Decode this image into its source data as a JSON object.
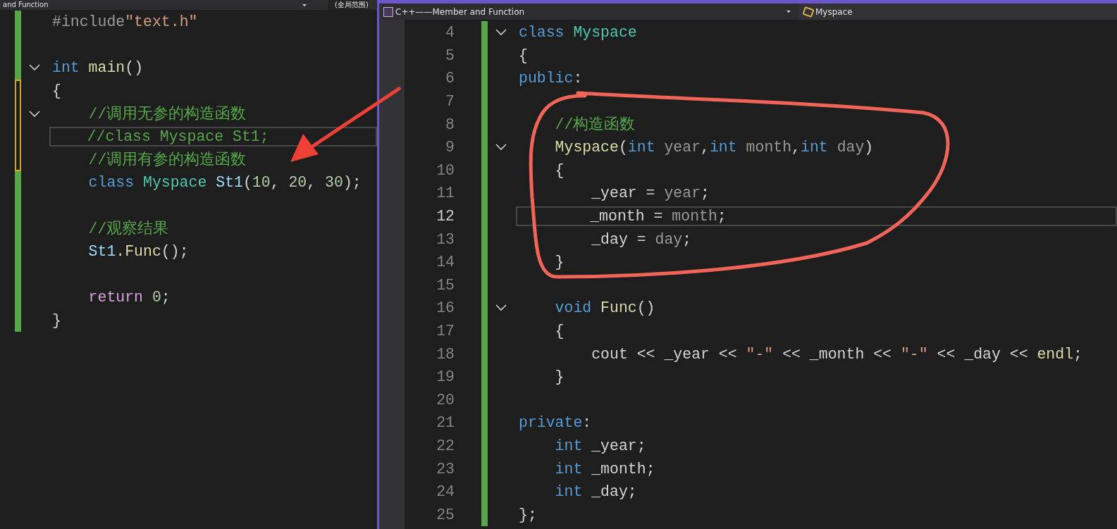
{
  "left_pane": {
    "nav_bar": {
      "project": "and Function",
      "scope": "(全局范围)"
    },
    "lines": [
      {
        "saved": true,
        "fold": false,
        "current": false,
        "tokens": [
          {
            "kind": "macro",
            "text": "#include"
          },
          {
            "kind": "string",
            "text": "\"text.h\""
          }
        ]
      },
      {
        "saved": true,
        "fold": false,
        "current": false
      },
      {
        "saved": true,
        "fold": true,
        "current": false,
        "tokens": [
          {
            "kind": "keyword",
            "text": "int"
          },
          {
            "kind": "function",
            "text": " main"
          },
          {
            "kind": "plain",
            "text": "()"
          }
        ]
      },
      {
        "saved": false,
        "fold": false,
        "current": false,
        "tokens": [
          {
            "kind": "plain",
            "text": "{"
          }
        ],
        "children": [
          {
            "saved": false,
            "fold": true,
            "current": false,
            "tokens": [
              {
                "kind": "comment",
                "text": "//调用无参的构造函数"
              }
            ]
          },
          {
            "saved": false,
            "fold": false,
            "current": true,
            "tokens": [
              {
                "kind": "comment",
                "text": "//class Myspace St1;"
              }
            ]
          },
          {
            "saved": false,
            "fold": false,
            "current": false,
            "tokens": [
              {
                "kind": "comment",
                "text": "//调用有参的构造函数"
              }
            ]
          },
          {
            "saved": true,
            "fold": false,
            "current": false,
            "tokens": [
              {
                "kind": "keyword",
                "text": "class"
              },
              {
                "kind": "type",
                "text": " Myspace"
              },
              {
                "kind": "variable",
                "text": " St1"
              },
              {
                "kind": "plain",
                "text": "("
              },
              {
                "kind": "number",
                "text": "10"
              },
              {
                "kind": "plain",
                "text": ", "
              },
              {
                "kind": "number",
                "text": "20"
              },
              {
                "kind": "plain",
                "text": ", "
              },
              {
                "kind": "number",
                "text": "30"
              },
              {
                "kind": "plain",
                "text": ");"
              }
            ]
          },
          {
            "saved": true,
            "fold": false,
            "current": false
          },
          {
            "saved": true,
            "fold": false,
            "current": false,
            "tokens": [
              {
                "kind": "comment",
                "text": "//观察结果"
              }
            ]
          },
          {
            "saved": true,
            "fold": false,
            "current": false,
            "tokens": [
              {
                "kind": "variable",
                "text": "St1"
              },
              {
                "kind": "plain",
                "text": "."
              },
              {
                "kind": "function",
                "text": "Func"
              },
              {
                "kind": "plain",
                "text": "();"
              }
            ]
          },
          {
            "saved": true,
            "fold": false,
            "current": false
          },
          {
            "saved": true,
            "fold": false,
            "current": false,
            "tokens": [
              {
                "kind": "control",
                "text": "return"
              },
              {
                "kind": "number",
                "text": " 0"
              },
              {
                "kind": "plain",
                "text": ";"
              }
            ]
          }
        ]
      },
      {
        "saved": true,
        "fold": false,
        "current": false,
        "tokens": [
          {
            "kind": "plain",
            "text": "}"
          }
        ]
      }
    ]
  },
  "right_pane": {
    "nav_bar": {
      "project": "C++——Member and Function",
      "scope": "Myspace"
    },
    "lines": [
      {
        "number": "4",
        "saved": true,
        "fold": true,
        "current": false,
        "tokens": [
          {
            "kind": "keyword",
            "text": "class"
          },
          {
            "kind": "type",
            "text": " Myspace"
          }
        ]
      },
      {
        "number": "5",
        "saved": true,
        "fold": false,
        "current": false,
        "tokens": [
          {
            "kind": "plain",
            "text": "{"
          }
        ]
      },
      {
        "number": "6",
        "saved": true,
        "fold": false,
        "current": false,
        "tokens": [
          {
            "kind": "keyword",
            "text": "public"
          },
          {
            "kind": "plain",
            "text": ":"
          }
        ],
        "children": [
          {
            "number": "7",
            "saved": true,
            "fold": false,
            "current": false
          },
          {
            "number": "8",
            "saved": true,
            "fold": false,
            "current": false,
            "tokens": [
              {
                "kind": "comment",
                "text": "//构造函数"
              }
            ]
          },
          {
            "number": "9",
            "saved": true,
            "fold": true,
            "current": false,
            "tokens": [
              {
                "kind": "function",
                "text": "Myspace"
              },
              {
                "kind": "plain",
                "text": "("
              },
              {
                "kind": "keyword",
                "text": "int"
              },
              {
                "kind": "param",
                "text": " year"
              },
              {
                "kind": "plain",
                "text": ","
              },
              {
                "kind": "keyword",
                "text": "int"
              },
              {
                "kind": "param",
                "text": " month"
              },
              {
                "kind": "plain",
                "text": ","
              },
              {
                "kind": "keyword",
                "text": "int"
              },
              {
                "kind": "param",
                "text": " day"
              },
              {
                "kind": "plain",
                "text": ")"
              }
            ]
          },
          {
            "number": "10",
            "saved": true,
            "fold": false,
            "current": false,
            "tokens": [
              {
                "kind": "plain",
                "text": "{"
              }
            ],
            "children": [
              {
                "number": "11",
                "saved": true,
                "fold": false,
                "current": false,
                "tokens": [
                  {
                    "kind": "plain",
                    "text": "_year = "
                  },
                  {
                    "kind": "param",
                    "text": "year"
                  },
                  {
                    "kind": "plain",
                    "text": ";"
                  }
                ]
              },
              {
                "number": "12",
                "saved": true,
                "fold": false,
                "current": true,
                "tokens": [
                  {
                    "kind": "plain",
                    "text": "_month = "
                  },
                  {
                    "kind": "param",
                    "text": "month"
                  },
                  {
                    "kind": "plain",
                    "text": ";"
                  }
                ]
              },
              {
                "number": "13",
                "saved": true,
                "fold": false,
                "current": false,
                "tokens": [
                  {
                    "kind": "plain",
                    "text": "_day = "
                  },
                  {
                    "kind": "param",
                    "text": "day"
                  },
                  {
                    "kind": "plain",
                    "text": ";"
                  }
                ]
              }
            ]
          },
          {
            "number": "14",
            "saved": true,
            "fold": false,
            "current": false,
            "tokens": [
              {
                "kind": "plain",
                "text": "}"
              }
            ]
          },
          {
            "number": "15",
            "saved": true,
            "fold": false,
            "current": false
          },
          {
            "number": "16",
            "saved": true,
            "fold": true,
            "current": false,
            "tokens": [
              {
                "kind": "keyword",
                "text": "void"
              },
              {
                "kind": "function",
                "text": " Func"
              },
              {
                "kind": "plain",
                "text": "()"
              }
            ]
          },
          {
            "number": "17",
            "saved": true,
            "fold": false,
            "current": false,
            "tokens": [
              {
                "kind": "plain",
                "text": "{"
              }
            ],
            "children": [
              {
                "number": "18",
                "saved": true,
                "fold": false,
                "current": false,
                "tokens": [
                  {
                    "kind": "plain",
                    "text": "cout << _year << "
                  },
                  {
                    "kind": "string",
                    "text": "\"-\""
                  },
                  {
                    "kind": "plain",
                    "text": " << _month << "
                  },
                  {
                    "kind": "string",
                    "text": "\"-\""
                  },
                  {
                    "kind": "plain",
                    "text": " << _day << "
                  },
                  {
                    "kind": "function",
                    "text": "endl"
                  },
                  {
                    "kind": "plain",
                    "text": ";"
                  }
                ]
              }
            ]
          },
          {
            "number": "19",
            "saved": true,
            "fold": false,
            "current": false,
            "tokens": [
              {
                "kind": "plain",
                "text": "}"
              }
            ]
          },
          {
            "number": "20",
            "saved": true,
            "fold": false,
            "current": false
          }
        ]
      },
      {
        "number": "21",
        "saved": true,
        "fold": false,
        "current": false,
        "tokens": [
          {
            "kind": "keyword",
            "text": "private"
          },
          {
            "kind": "plain",
            "text": ":"
          }
        ],
        "children": [
          {
            "number": "22",
            "saved": true,
            "fold": false,
            "current": false,
            "tokens": [
              {
                "kind": "keyword",
                "text": "int"
              },
              {
                "kind": "plain",
                "text": " _year;"
              }
            ]
          },
          {
            "number": "23",
            "saved": true,
            "fold": false,
            "current": false,
            "tokens": [
              {
                "kind": "keyword",
                "text": "int"
              },
              {
                "kind": "plain",
                "text": " _month;"
              }
            ]
          },
          {
            "number": "24",
            "saved": true,
            "fold": false,
            "current": false,
            "tokens": [
              {
                "kind": "keyword",
                "text": "int"
              },
              {
                "kind": "plain",
                "text": " _day;"
              }
            ]
          }
        ]
      },
      {
        "number": "25",
        "saved": true,
        "fold": false,
        "current": false,
        "tokens": [
          {
            "kind": "plain",
            "text": "};"
          }
        ]
      }
    ]
  }
}
